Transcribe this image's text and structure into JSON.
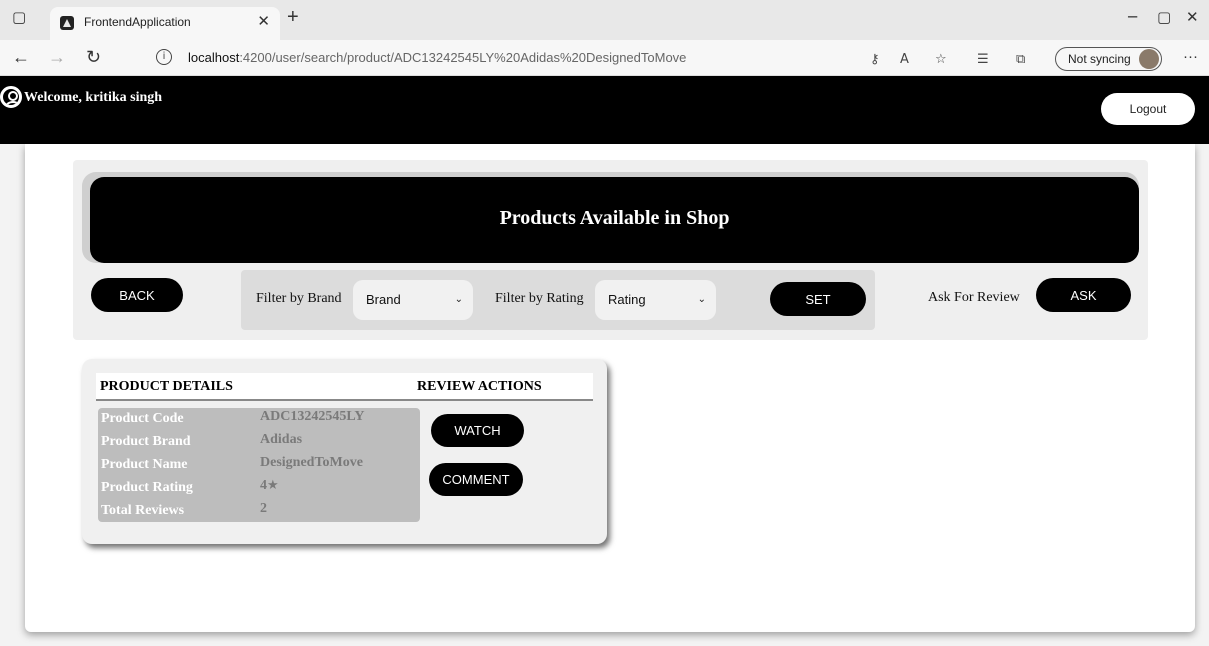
{
  "browser": {
    "tab_title": "FrontendApplication",
    "url_host": "localhost",
    "url_path": ":4200/user/search/product/ADC13242545LY%20Adidas%20DesignedToMove",
    "sync_label": "Not syncing"
  },
  "header": {
    "welcome": "Welcome, kritika singh",
    "logout_label": "Logout"
  },
  "banner": {
    "title": "Products Available in Shop"
  },
  "controls": {
    "back_label": "BACK",
    "filter_brand_label": "Filter by Brand",
    "brand_select_value": "Brand",
    "filter_rating_label": "Filter by Rating",
    "rating_select_value": "Rating",
    "set_label": "SET",
    "ask_review_label": "Ask For Review",
    "ask_label": "ASK"
  },
  "product_card": {
    "details_heading": "PRODUCT DETAILS",
    "actions_heading": "REVIEW ACTIONS",
    "rows": [
      {
        "label": "Product Code",
        "value": "ADC13242545LY"
      },
      {
        "label": "Product Brand",
        "value": "Adidas"
      },
      {
        "label": "Product Name",
        "value": "DesignedToMove"
      },
      {
        "label": "Product Rating",
        "value": "4"
      },
      {
        "label": "Total Reviews",
        "value": "2"
      }
    ],
    "watch_label": "WATCH",
    "comment_label": "COMMENT"
  }
}
